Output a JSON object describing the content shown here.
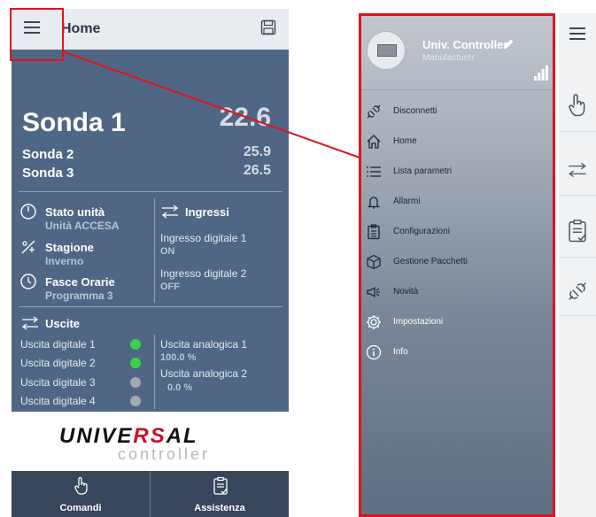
{
  "left": {
    "title": "Home",
    "probes": [
      {
        "label": "Sonda 1",
        "value": "22.6"
      },
      {
        "label": "Sonda 2",
        "value": "25.9"
      },
      {
        "label": "Sonda 3",
        "value": "26.5"
      }
    ],
    "status": [
      {
        "title": "Stato unità",
        "sub": "Unità ACCESA",
        "icon": "power-icon"
      },
      {
        "title": "Stagione",
        "sub": "Inverno",
        "icon": "season-icon"
      },
      {
        "title": "Fasce Orarie",
        "sub": "Programma 3",
        "icon": "clock-icon"
      }
    ],
    "inputs": {
      "title": "Ingressi",
      "items": [
        {
          "label": "Ingresso digitale 1",
          "value": "ON"
        },
        {
          "label": "Ingresso digitale 2",
          "value": "OFF"
        }
      ]
    },
    "outputs": {
      "title": "Uscite",
      "digital": [
        {
          "label": "Uscita digitale 1",
          "state": "on"
        },
        {
          "label": "Uscita digitale 2",
          "state": "on"
        },
        {
          "label": "Uscita digitale 3",
          "state": "off"
        },
        {
          "label": "Uscita digitale 4",
          "state": "off"
        }
      ],
      "analog": [
        {
          "label": "Uscita analogica 1",
          "value": "100.0 %"
        },
        {
          "label": "Uscita analogica 2",
          "value": "0.0 %"
        }
      ]
    },
    "logo": {
      "part1": "UNIVE",
      "part2": "RS",
      "part3": "AL",
      "sub": "controller"
    },
    "bottom": {
      "commands": "Comandi",
      "support": "Assistenza"
    }
  },
  "right": {
    "device": {
      "name": "Univ. Controller",
      "manufacturer": "Manufacturer"
    },
    "menu": [
      {
        "label": "Disconnetti",
        "icon": "disconnect-icon"
      },
      {
        "label": "Home",
        "icon": "home-icon"
      },
      {
        "label": "Lista parametri",
        "icon": "list-icon"
      },
      {
        "label": "Allarmi",
        "icon": "bell-icon"
      },
      {
        "label": "Configurazioni",
        "icon": "clipboard-icon"
      },
      {
        "label": "Gestione Pacchetti",
        "icon": "package-icon"
      },
      {
        "label": "Novità",
        "icon": "megaphone-icon"
      },
      {
        "label": "Impostazioni",
        "icon": "gear-icon"
      },
      {
        "label": "Info",
        "icon": "info-icon"
      }
    ]
  },
  "colors": {
    "accent_red": "#e0131c",
    "panel": "#4f6784",
    "led_on": "#3fcf4f",
    "led_off": "#a3a9b0"
  }
}
